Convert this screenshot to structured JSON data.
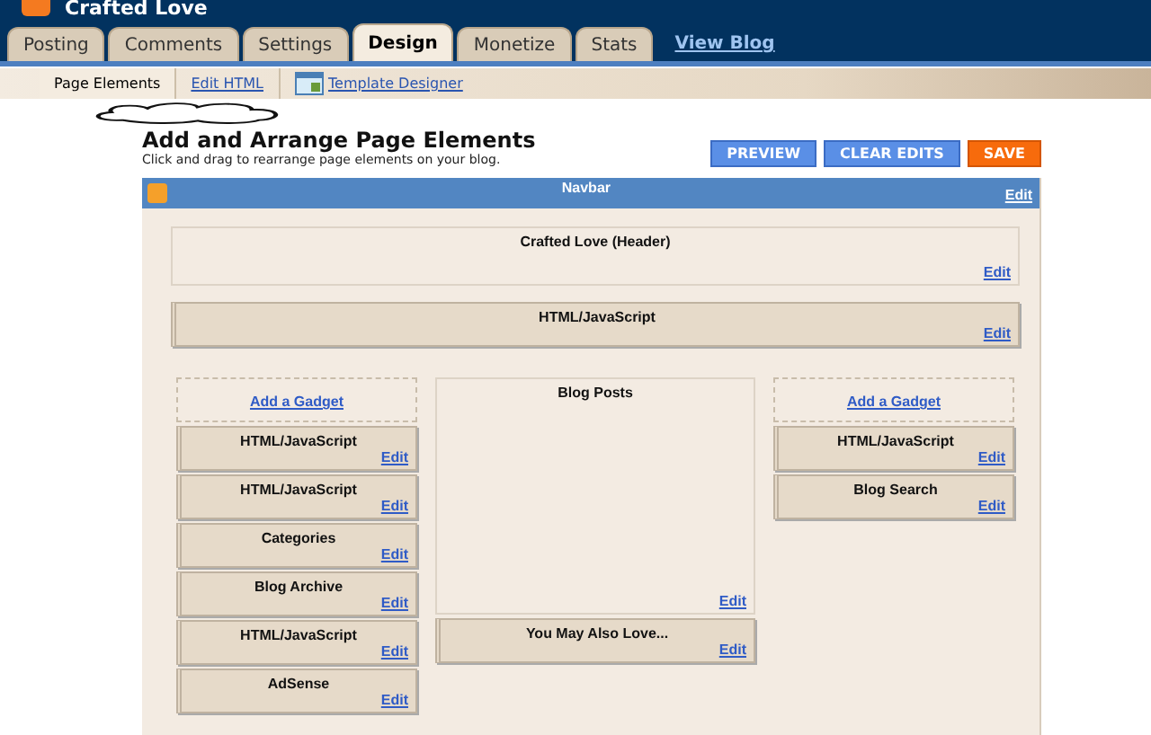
{
  "blog_title": "Crafted Love",
  "tabs": [
    {
      "label": "Posting",
      "selected": false
    },
    {
      "label": "Comments",
      "selected": false
    },
    {
      "label": "Settings",
      "selected": false
    },
    {
      "label": "Design",
      "selected": true
    },
    {
      "label": "Monetize",
      "selected": false
    },
    {
      "label": "Stats",
      "selected": false
    }
  ],
  "view_blog": "View Blog",
  "subtabs": [
    {
      "label": "Page Elements",
      "selected": true,
      "kind": "text"
    },
    {
      "label": "Edit HTML",
      "selected": false,
      "kind": "text"
    },
    {
      "label": "Template Designer",
      "selected": false,
      "kind": "icon"
    }
  ],
  "heading": "Add and Arrange Page Elements",
  "subheading": "Click and drag to rearrange page elements on your blog.",
  "buttons": [
    {
      "label": "PREVIEW",
      "kind": "blue"
    },
    {
      "label": "CLEAR EDITS",
      "kind": "blue"
    },
    {
      "label": "SAVE",
      "kind": "orange"
    }
  ],
  "navbar": {
    "title": "Navbar",
    "edit": "Edit"
  },
  "header_gadget": {
    "title": "Crafted Love (Header)",
    "edit": "Edit"
  },
  "top_gadget": {
    "title": "HTML/JavaScript",
    "edit": "Edit"
  },
  "left_column": {
    "add": "Add a Gadget",
    "gadgets": [
      {
        "title": "HTML/JavaScript",
        "edit": "Edit"
      },
      {
        "title": "HTML/JavaScript",
        "edit": "Edit"
      },
      {
        "title": "Categories",
        "edit": "Edit"
      },
      {
        "title": "Blog Archive",
        "edit": "Edit"
      },
      {
        "title": "HTML/JavaScript",
        "edit": "Edit"
      },
      {
        "title": "AdSense",
        "edit": "Edit"
      }
    ]
  },
  "main_column": {
    "posts": {
      "title": "Blog Posts",
      "edit": "Edit"
    },
    "gadgets": [
      {
        "title": "You May Also Love...",
        "edit": "Edit"
      }
    ]
  },
  "right_column": {
    "add": "Add a Gadget",
    "gadgets": [
      {
        "title": "HTML/JavaScript",
        "edit": "Edit"
      },
      {
        "title": "Blog Search",
        "edit": "Edit"
      }
    ]
  }
}
